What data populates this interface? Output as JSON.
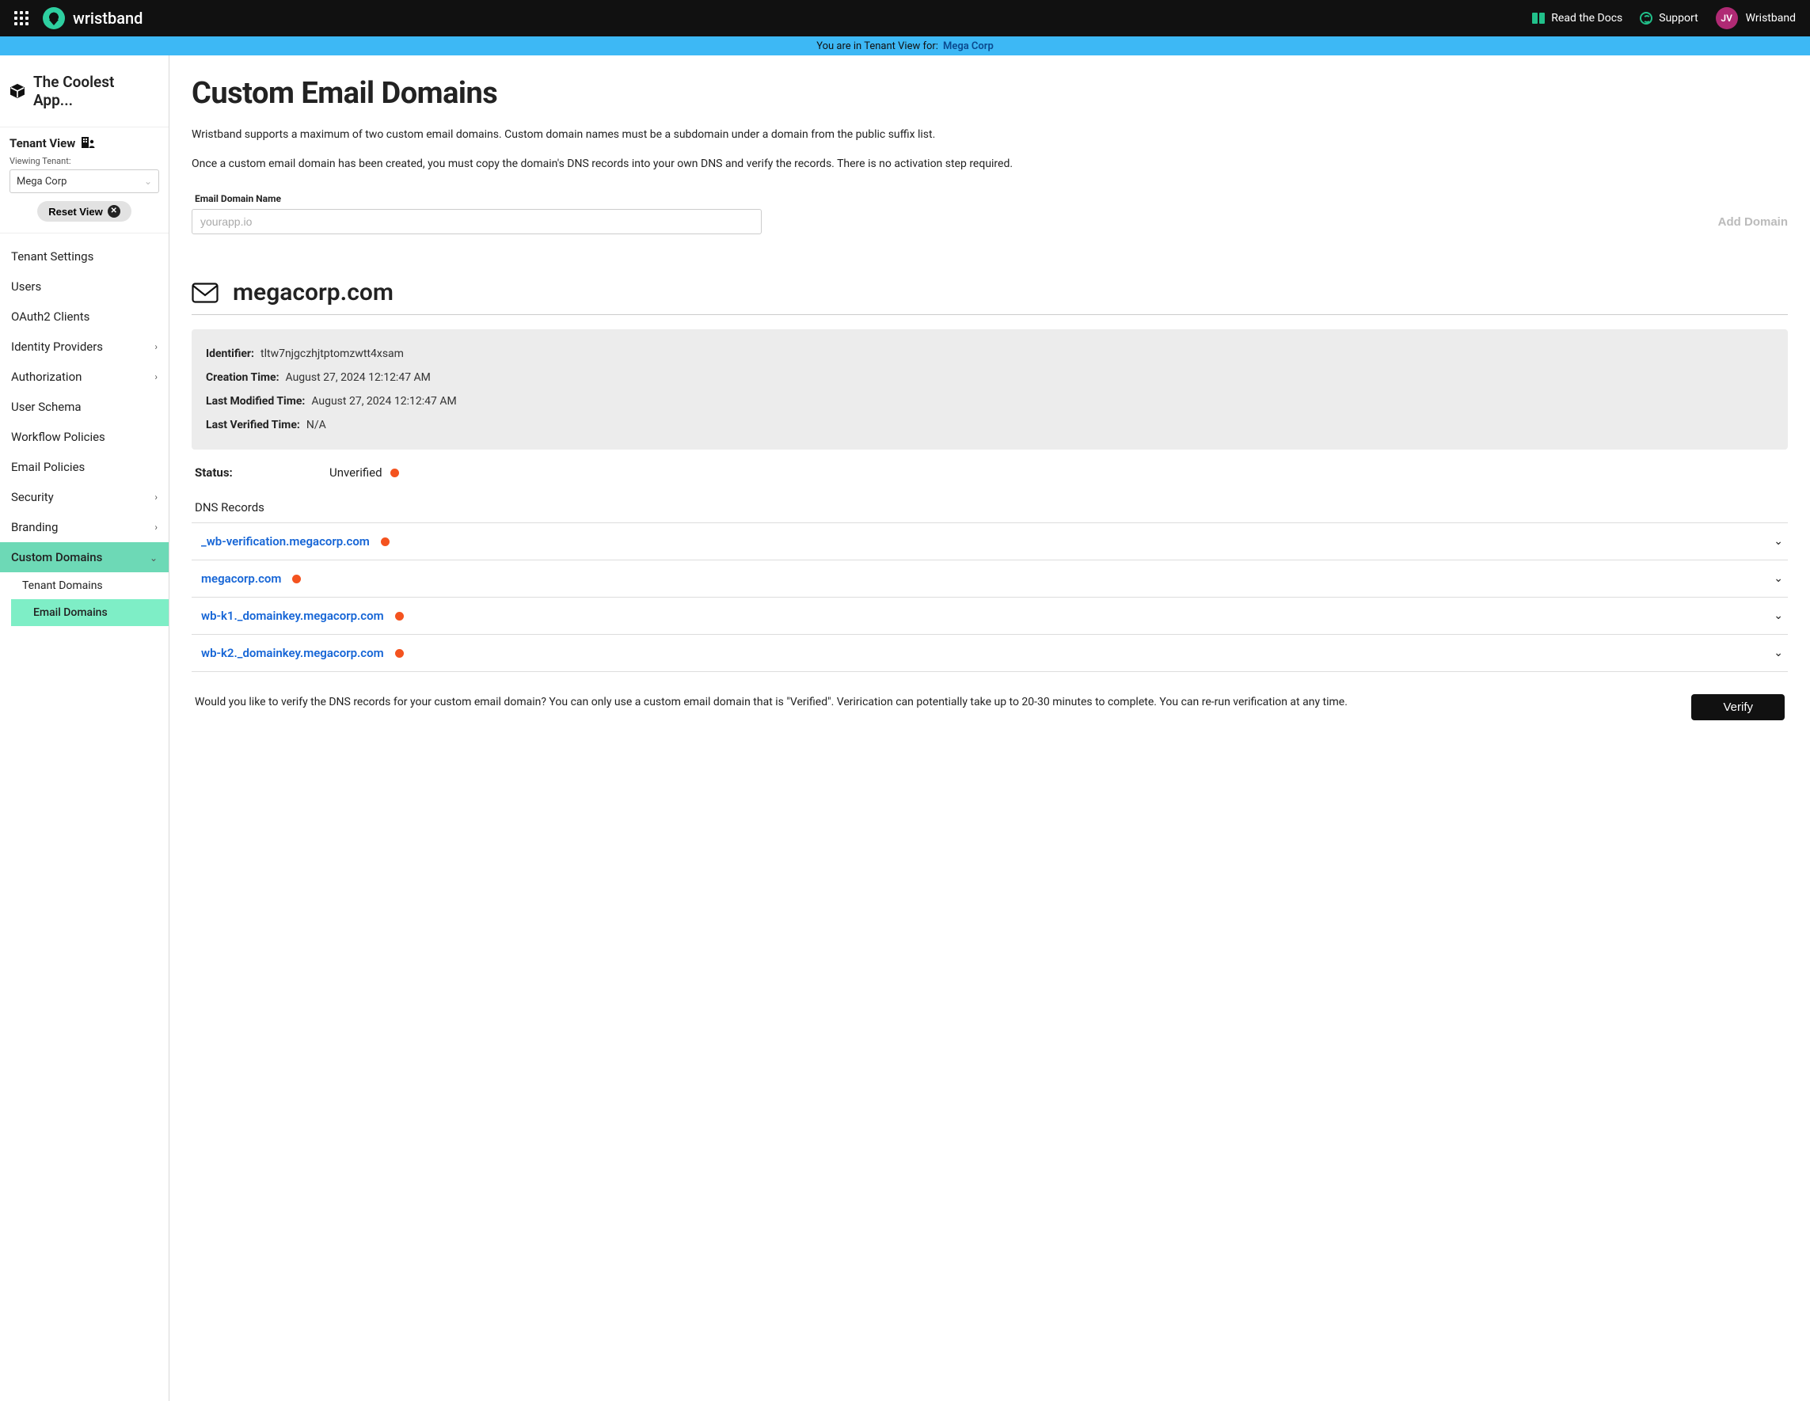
{
  "topbar": {
    "brand": "wristband",
    "docs_label": "Read the Docs",
    "support_label": "Support",
    "avatar_initials": "JV",
    "tenant_display": "Wristband"
  },
  "banner": {
    "prefix": "You are in Tenant View for:",
    "tenant": "Mega Corp"
  },
  "sidebar": {
    "app_name": "The Coolest App...",
    "tenant_view_label": "Tenant View",
    "viewing_label": "Viewing Tenant:",
    "tenant_selected": "Mega Corp",
    "reset_label": "Reset View",
    "items": [
      {
        "label": "Tenant Settings",
        "expandable": false
      },
      {
        "label": "Users",
        "expandable": false
      },
      {
        "label": "OAuth2 Clients",
        "expandable": false
      },
      {
        "label": "Identity Providers",
        "expandable": true
      },
      {
        "label": "Authorization",
        "expandable": true
      },
      {
        "label": "User Schema",
        "expandable": false
      },
      {
        "label": "Workflow Policies",
        "expandable": false
      },
      {
        "label": "Email Policies",
        "expandable": false
      },
      {
        "label": "Security",
        "expandable": true
      },
      {
        "label": "Branding",
        "expandable": true
      },
      {
        "label": "Custom Domains",
        "expandable": true
      }
    ],
    "custom_domains_children": [
      {
        "label": "Tenant Domains",
        "active": false
      },
      {
        "label": "Email Domains",
        "active": true
      }
    ]
  },
  "page": {
    "title": "Custom Email Domains",
    "intro1": "Wristband supports a maximum of two custom email domains. Custom domain names must be a subdomain under a domain from the public suffix list.",
    "intro2": "Once a custom email domain has been created, you must copy the domain's DNS records into your own DNS and verify the records. There is no activation step required.",
    "field_label": "Email Domain Name",
    "field_placeholder": "yourapp.io",
    "add_domain_label": "Add Domain"
  },
  "domain": {
    "name": "megacorp.com",
    "info": {
      "identifier_k": "Identifier:",
      "identifier_v": "tltw7njgczhjtptomzwtt4xsam",
      "created_k": "Creation Time:",
      "created_v": "August 27, 2024 12:12:47 AM",
      "modified_k": "Last Modified Time:",
      "modified_v": "August 27, 2024 12:12:47 AM",
      "verified_k": "Last Verified Time:",
      "verified_v": "N/A"
    },
    "status_label": "Status:",
    "status_value": "Unverified",
    "status_color": "orange",
    "dns_heading": "DNS Records",
    "dns_records": [
      {
        "name": "_wb-verification.megacorp.com",
        "status": "orange"
      },
      {
        "name": "megacorp.com",
        "status": "orange"
      },
      {
        "name": "wb-k1._domainkey.megacorp.com",
        "status": "orange"
      },
      {
        "name": "wb-k2._domainkey.megacorp.com",
        "status": "orange"
      }
    ],
    "verify_text": "Would you like to verify the DNS records for your custom email domain? You can only use a custom email domain that is \"Verified\". Verirication can potentially take up to 20-30 minutes to complete. You can re-run verification at any time.",
    "verify_button": "Verify"
  }
}
